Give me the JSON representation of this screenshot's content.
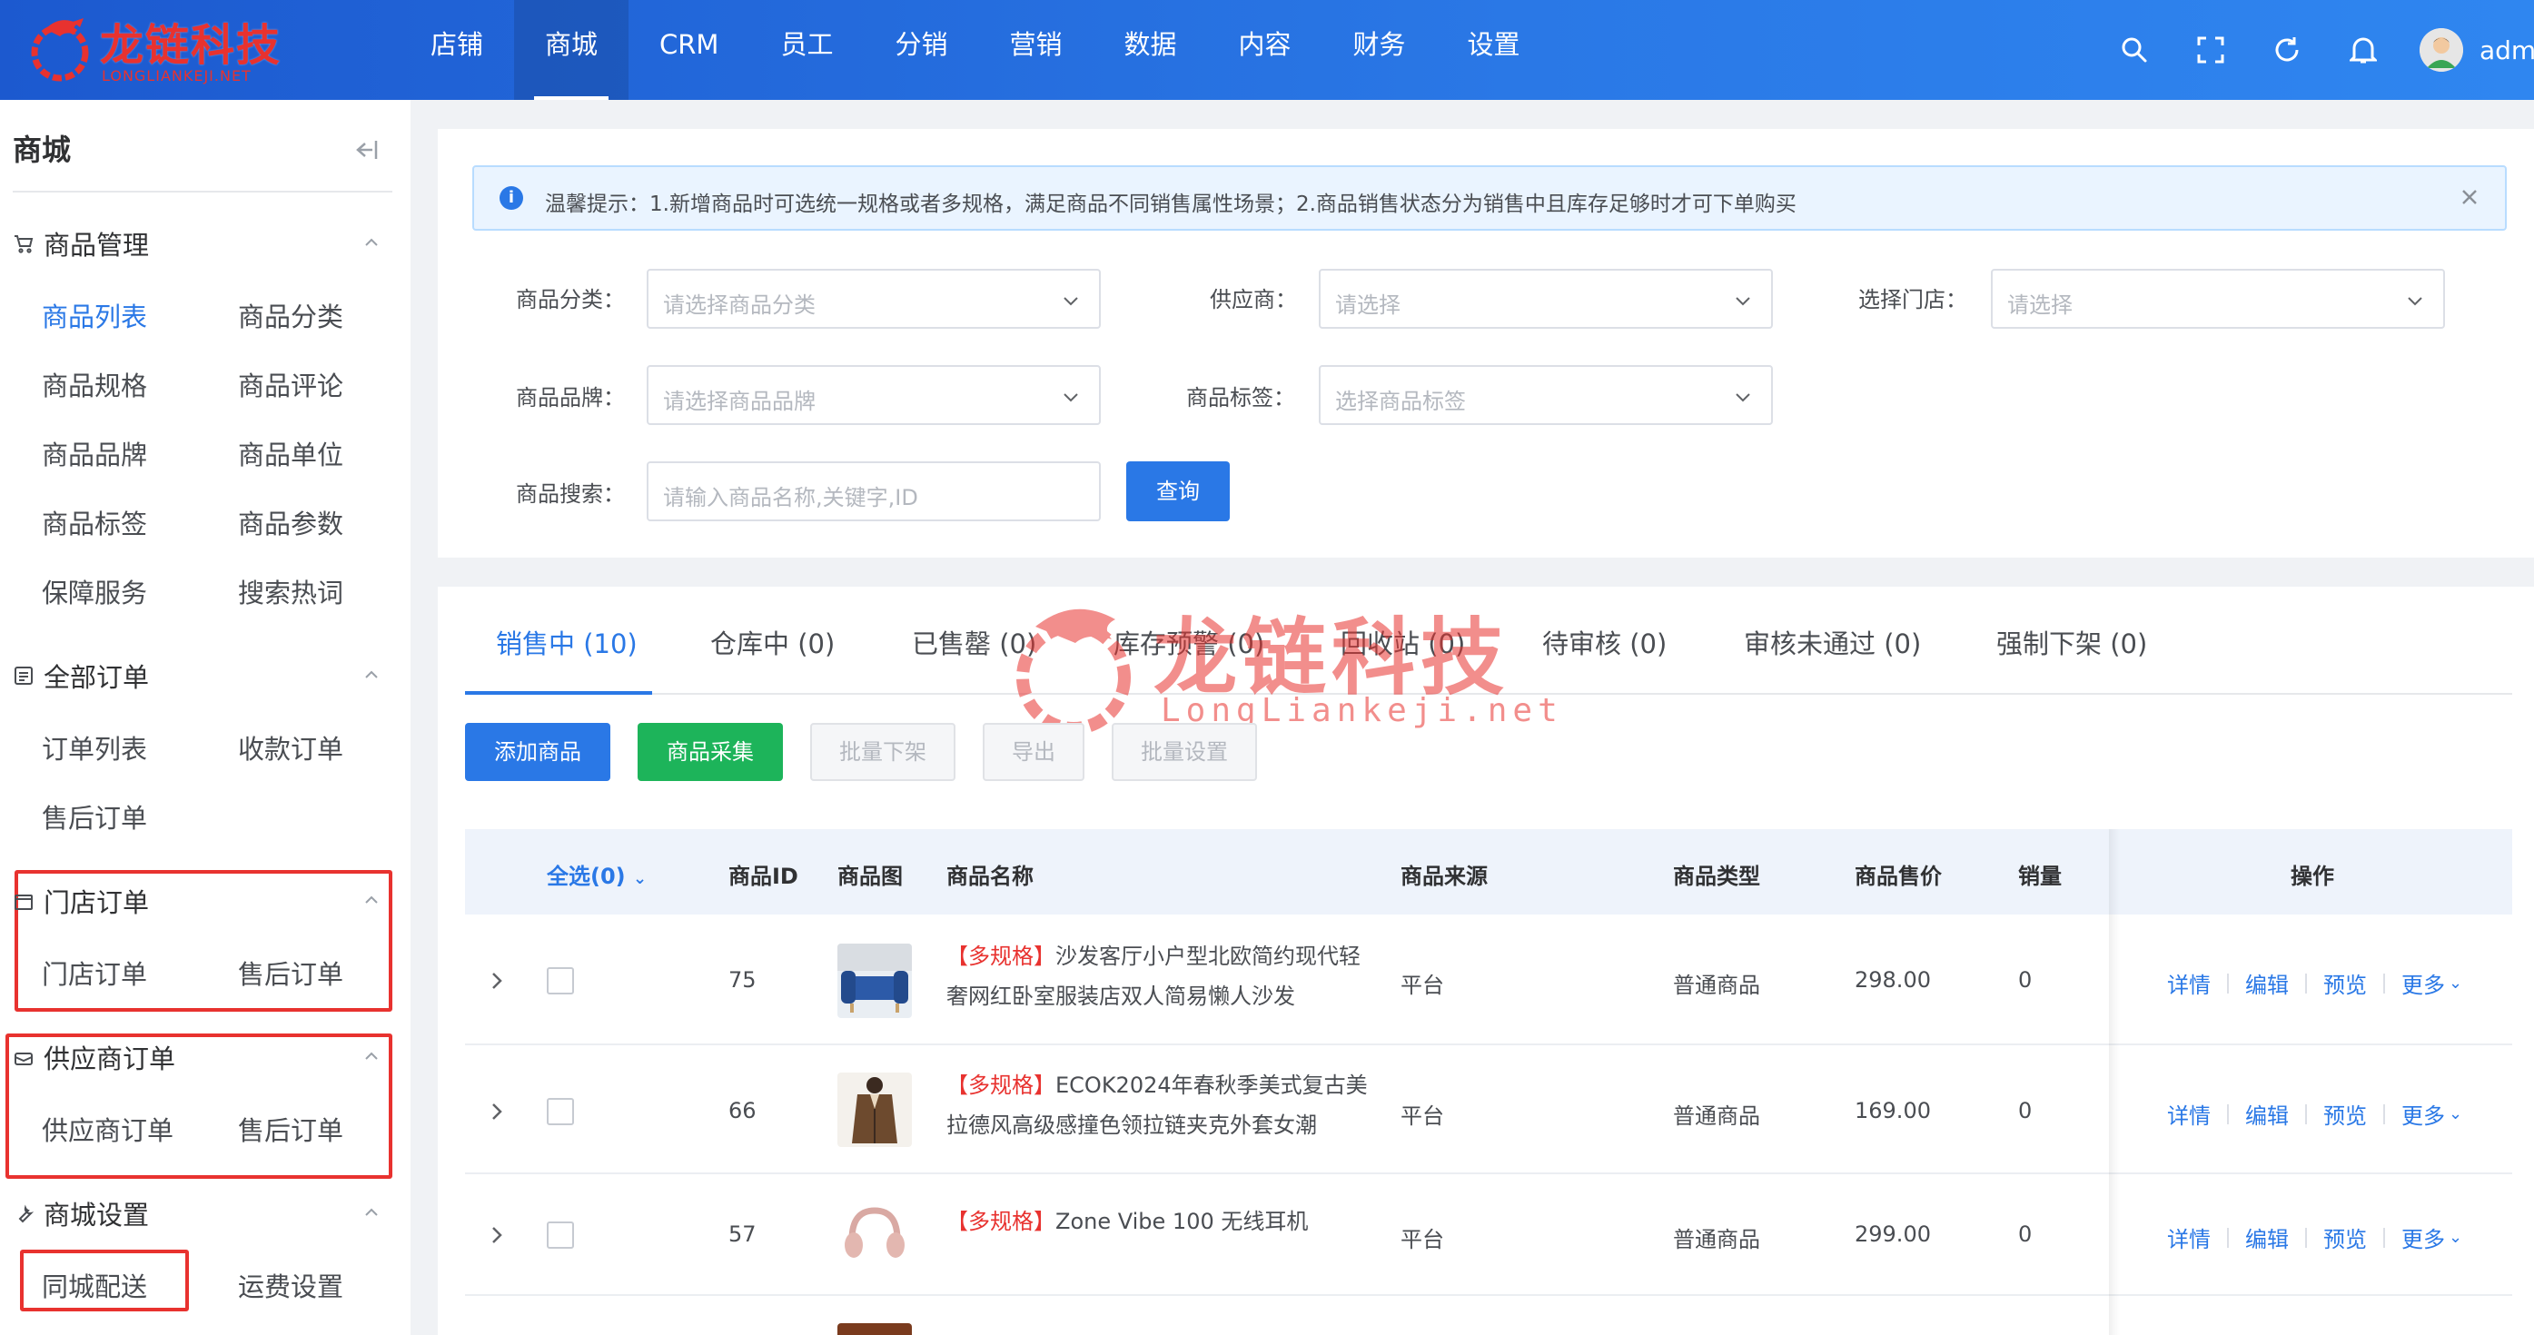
{
  "brand": {
    "name_cn": "龙链科技",
    "name_en": "LONGLIANKEJI.NET",
    "color": "#e8322f"
  },
  "topnav": {
    "items": [
      "店铺",
      "商城",
      "CRM",
      "员工",
      "分销",
      "营销",
      "数据",
      "内容",
      "财务",
      "设置"
    ],
    "active_index": 1,
    "icons": [
      "search-icon",
      "fullscreen-icon",
      "refresh-icon",
      "bell-icon"
    ],
    "username": "admin"
  },
  "sidebar": {
    "title": "商城",
    "groups": [
      {
        "label": "商品管理",
        "icon": "cart-icon",
        "links": [
          "商品列表",
          "商品分类",
          "商品规格",
          "商品评论",
          "商品品牌",
          "商品单位",
          "商品标签",
          "商品参数",
          "保障服务",
          "搜索热词"
        ],
        "active": "商品列表"
      },
      {
        "label": "全部订单",
        "icon": "order-icon",
        "links": [
          "订单列表",
          "收款订单",
          "售后订单"
        ]
      },
      {
        "label": "门店订单",
        "icon": "store-icon",
        "links": [
          "门店订单",
          "售后订单"
        ]
      },
      {
        "label": "供应商订单",
        "icon": "supplier-icon",
        "links": [
          "供应商订单",
          "售后订单"
        ]
      },
      {
        "label": "商城设置",
        "icon": "wrench-icon",
        "links": [
          "同城配送",
          "运费设置"
        ]
      }
    ]
  },
  "alert": {
    "text": "温馨提示：1.新增商品时可选统一规格或者多规格，满足商品不同销售属性场景；2.商品销售状态分为销售中且库存足够时才可下单购买"
  },
  "filters": {
    "category": {
      "label": "商品分类：",
      "placeholder": "请选择商品分类"
    },
    "supplier": {
      "label": "供应商：",
      "placeholder": "请选择"
    },
    "store": {
      "label": "选择门店：",
      "placeholder": "请选择"
    },
    "brand": {
      "label": "商品品牌：",
      "placeholder": "请选择商品品牌"
    },
    "tag": {
      "label": "商品标签：",
      "placeholder": "选择商品标签"
    },
    "search": {
      "label": "商品搜索：",
      "placeholder": "请输入商品名称,关键字,ID"
    },
    "query_button": "查询"
  },
  "tabs": [
    "销售中 (10)",
    "仓库中 (0)",
    "已售罄 (0)",
    "库存预警 (0)",
    "回收站 (0)",
    "待审核 (0)",
    "审核未通过 (0)",
    "强制下架 (0)"
  ],
  "watermark": {
    "cn": "龙链科技",
    "en": "LongLiankeji.net"
  },
  "actions": {
    "add": "添加商品",
    "collect": "商品采集",
    "batch_off": "批量下架",
    "export": "导出",
    "batch_set": "批量设置"
  },
  "table": {
    "select_all": "全选(0)",
    "columns": [
      "商品ID",
      "商品图",
      "商品名称",
      "商品来源",
      "商品类型",
      "商品售价",
      "销量",
      "操作"
    ],
    "rows": [
      {
        "id": "75",
        "tag": "【多规格】",
        "name": "沙发客厅小户型北欧简约现代轻奢网红卧室服装店双人简易懒人沙发",
        "source": "平台",
        "type": "普通商品",
        "price": "298.00",
        "sales": "0"
      },
      {
        "id": "66",
        "tag": "【多规格】",
        "name": "ECOK2024年春秋季美式复古美拉德风高级感撞色领拉链夹克外套女潮",
        "source": "平台",
        "type": "普通商品",
        "price": "169.00",
        "sales": "0"
      },
      {
        "id": "57",
        "tag": "【多规格】",
        "name": "Zone Vibe 100 无线耳机",
        "source": "平台",
        "type": "普通商品",
        "price": "299.00",
        "sales": "0"
      }
    ],
    "row_ops": [
      "详情",
      "编辑",
      "预览",
      "更多"
    ]
  },
  "colors": {
    "primary": "#2a78e6",
    "success": "#1db45a",
    "danger": "#e8322f"
  }
}
